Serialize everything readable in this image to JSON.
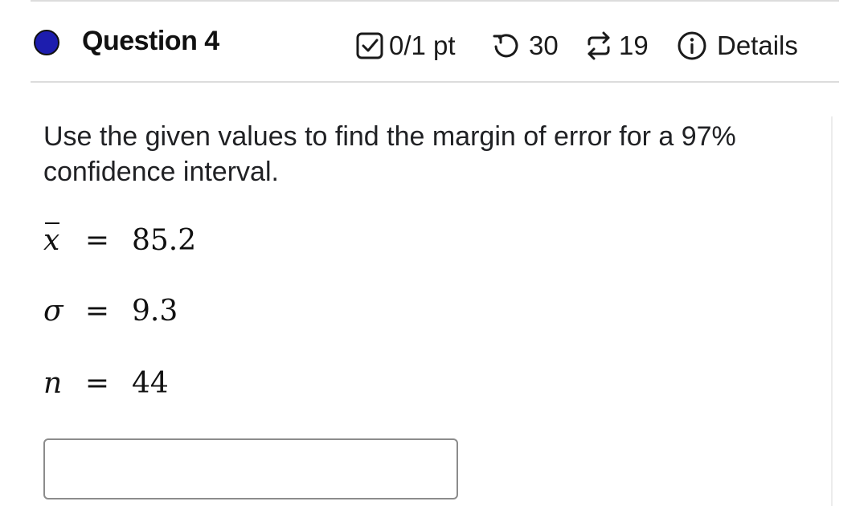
{
  "question": {
    "title": "Question 4",
    "status_color": "#1d1dae",
    "score": "0/1 pt",
    "retries": "30",
    "attempts": "19",
    "details_label": "Details",
    "icons": {
      "score": "checkbox-icon",
      "retries": "retry-icon",
      "attempts": "attempts-icon",
      "details": "info-icon"
    }
  },
  "problem": {
    "prompt": "Use the given values to find the margin of error for a 97% confidence interval.",
    "equations": [
      {
        "var": "x̄",
        "op": "=",
        "value": "85.2"
      },
      {
        "var": "σ",
        "op": "=",
        "value": "9.3"
      },
      {
        "var": "n",
        "op": "=",
        "value": "44"
      }
    ]
  },
  "answer": {
    "value": "",
    "placeholder": ""
  }
}
